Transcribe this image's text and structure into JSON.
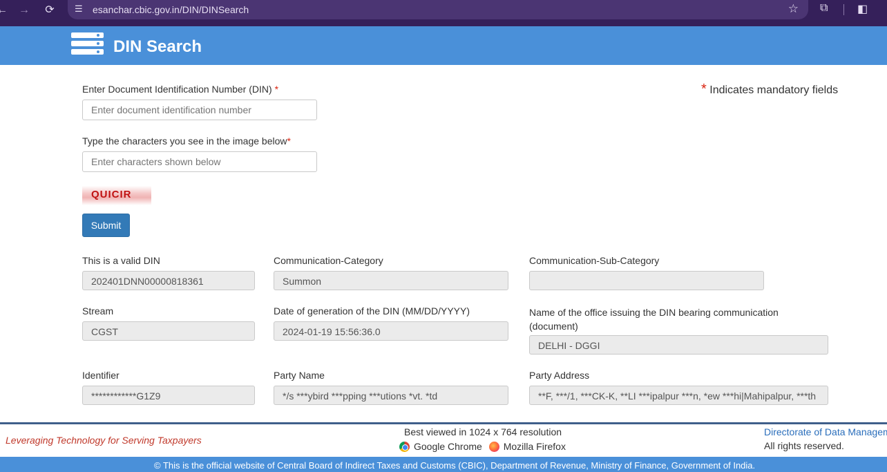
{
  "browser": {
    "url": "esanchar.cbic.gov.in/DIN/DINSearch",
    "icons": [
      "back-icon",
      "forward-icon",
      "reload-icon",
      "site-info-icon",
      "bookmark-star-icon",
      "extensions-icon",
      "side-panel-icon"
    ]
  },
  "header": {
    "title": "DIN Search"
  },
  "form": {
    "din_label": "Enter Document Identification Number (DIN)",
    "din_placeholder": "Enter document identification number",
    "captcha_label": "Type the characters you see in the image below",
    "captcha_placeholder": "Enter characters shown below",
    "captcha_text": "QUICIR",
    "required_mark": "*",
    "submit_label": "Submit",
    "mandatory_note": "Indicates mandatory fields"
  },
  "result": {
    "valid_label": "This is a valid DIN",
    "valid_value": "202401DNN00000818361",
    "category_label": "Communication-Category",
    "category_value": "Summon",
    "subcategory_label": "Communication-Sub-Category",
    "subcategory_value": "",
    "stream_label": "Stream",
    "stream_value": "CGST",
    "date_label": "Date of generation of the DIN (MM/DD/YYYY)",
    "date_value": "2024-01-19 15:56:36.0",
    "office_label": "Name of the office issuing the DIN bearing communication (document)",
    "office_value": "DELHI - DGGI",
    "identifier_label": "Identifier",
    "identifier_value": "************G1Z9",
    "party_name_label": "Party Name",
    "party_name_value": "*/s ***ybird ***pping ***utions *vt. *td",
    "party_address_label": "Party Address",
    "party_address_value": "**F, ***/1, ***CK-K, **LI ***ipalpur ***n, *ew ***hi|Mahipalpur, ***th"
  },
  "footer": {
    "tagline": "Leveraging Technology for Serving Taxpayers",
    "best_viewed": "Best viewed in 1024 x 764 resolution",
    "browser_chrome": "Google Chrome",
    "browser_firefox": "Mozilla Firefox",
    "directorate": "Directorate of Data Managem",
    "rights": "All rights reserved.",
    "official": "© This is the official website of Central Board of Indirect Taxes and Customs (CBIC), Department of Revenue, Ministry of Finance, Government of India."
  },
  "colors": {
    "header": "#4a90d9",
    "submit": "#337ab7",
    "required": "#d9230f",
    "chrome_bg": "#35205a"
  }
}
